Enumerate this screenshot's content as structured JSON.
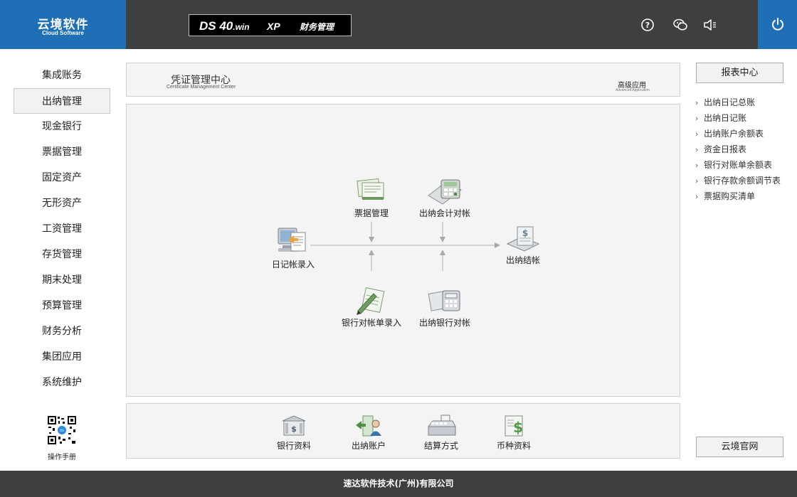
{
  "header": {
    "logo_cn": "云境软件",
    "logo_en": "Cloud Software",
    "product_ds": "DS 40",
    "product_win": ".win",
    "product_xp": "XP",
    "product_module": "财务管理",
    "icons": [
      "help-icon",
      "wechat-icon",
      "sound-icon",
      "power-icon"
    ]
  },
  "sidebar": {
    "items": [
      {
        "label": "集成账务"
      },
      {
        "label": "出纳管理",
        "active": true
      },
      {
        "label": "现金银行"
      },
      {
        "label": "票据管理"
      },
      {
        "label": "固定资产"
      },
      {
        "label": "无形资产"
      },
      {
        "label": "工资管理"
      },
      {
        "label": "存货管理"
      },
      {
        "label": "期末处理"
      },
      {
        "label": "预算管理"
      },
      {
        "label": "财务分析"
      },
      {
        "label": "集团应用"
      },
      {
        "label": "系统维护"
      }
    ],
    "manual_label": "操作手册"
  },
  "center": {
    "title": "凭证管理中心",
    "subtitle": "Certificate Management Center",
    "advanced": "高级应用",
    "advanced_en": "Advanced Application"
  },
  "flow": {
    "journal_entry": "日记帐录入",
    "bill_mgmt": "票据管理",
    "cash_acct_reconcile": "出纳会计对帐",
    "bank_statement_entry": "银行对帐单录入",
    "cash_bank_reconcile": "出纳银行对帐",
    "cash_close": "出纳结帐"
  },
  "tools": {
    "bank_info": "银行资料",
    "cash_account": "出纳账户",
    "settlement": "结算方式",
    "currency": "币种资料"
  },
  "right": {
    "report_center": "报表中心",
    "reports": [
      "出纳日记总账",
      "出纳日记账",
      "出纳账户余额表",
      "资金日报表",
      "银行对账单余额表",
      "银行存款余额调节表",
      "票据购买清单"
    ],
    "website": "云境官网"
  },
  "footer": {
    "company": "速达软件技术(广州)有限公司"
  },
  "colors": {
    "brand_blue": "#1f6fb6",
    "header_dark": "#3f3f3f",
    "panel_bg": "#f4f4f4"
  }
}
